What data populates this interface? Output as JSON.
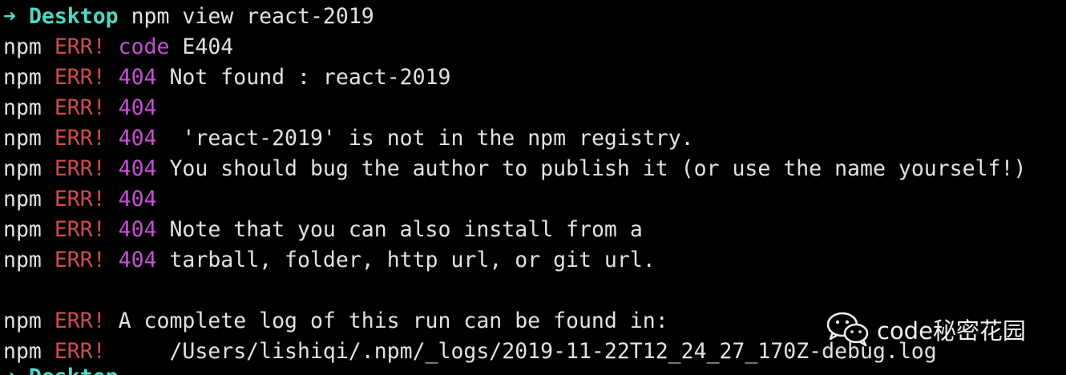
{
  "colors": {
    "background": "#000000",
    "prompt": "#4ed9c4",
    "text": "#e2e2e2",
    "error": "#d04c4a",
    "code": "#c74fd6"
  },
  "prompt": {
    "arrow": "➜",
    "cwd": "Desktop",
    "command": "npm view react-2019"
  },
  "lines": [
    {
      "prefix": "npm",
      "level": "ERR!",
      "code": "code",
      "message": " E404"
    },
    {
      "prefix": "npm",
      "level": "ERR!",
      "code": "404",
      "message": " Not found : react-2019"
    },
    {
      "prefix": "npm",
      "level": "ERR!",
      "code": "404",
      "message": ""
    },
    {
      "prefix": "npm",
      "level": "ERR!",
      "code": "404",
      "message": "  'react-2019' is not in the npm registry."
    },
    {
      "prefix": "npm",
      "level": "ERR!",
      "code": "404",
      "message": " You should bug the author to publish it (or use the name yourself!)"
    },
    {
      "prefix": "npm",
      "level": "ERR!",
      "code": "404",
      "message": ""
    },
    {
      "prefix": "npm",
      "level": "ERR!",
      "code": "404",
      "message": " Note that you can also install from a"
    },
    {
      "prefix": "npm",
      "level": "ERR!",
      "code": "404",
      "message": " tarball, folder, http url, or git url."
    }
  ],
  "log_lines": [
    {
      "prefix": "npm",
      "level": "ERR!",
      "message": " A complete log of this run can be found in:"
    },
    {
      "prefix": "npm",
      "level": "ERR!",
      "message": "     /Users/lishiqi/.npm/_logs/2019-11-22T12_24_27_170Z-debug.log"
    }
  ],
  "watermark": {
    "icon": "wechat-icon",
    "text": "code秘密花园"
  }
}
